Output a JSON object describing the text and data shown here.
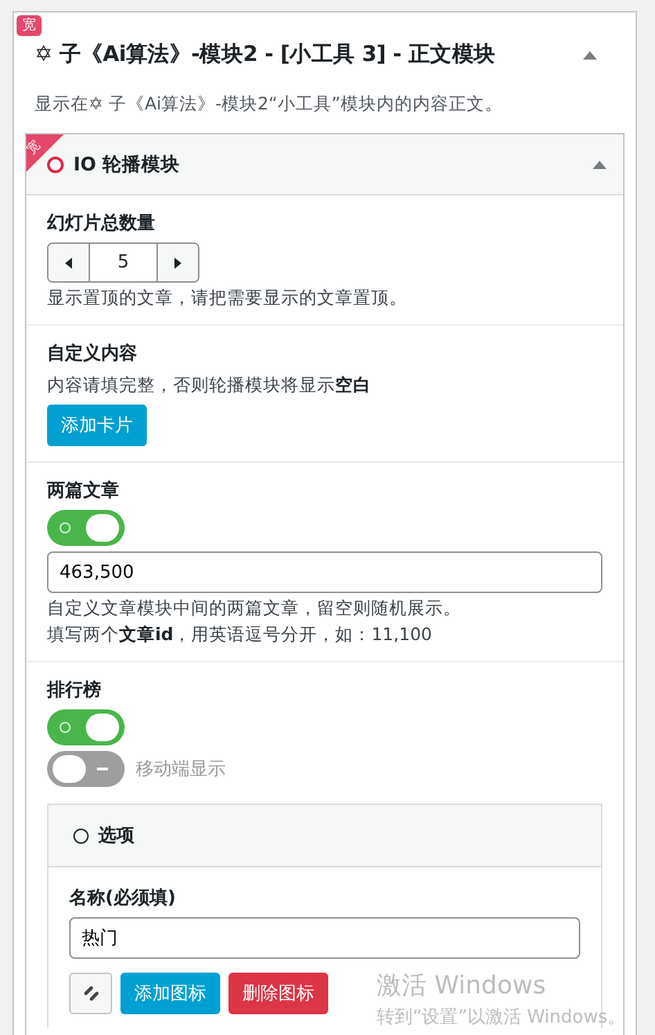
{
  "panel": {
    "badge": "宽",
    "title": "✡ 子《Ai算法》-模块2 - [小工具 3] - 正文模块",
    "expanded": true,
    "description": "显示在✡ 子《Ai算法》-模块2“小工具”模块内的内容正文。",
    "module": {
      "badge": "宽",
      "title": "IO 轮播模块",
      "expanded": true,
      "fields": [
        {
          "kind": "stepper",
          "label": "幻灯片总数量",
          "value": "5",
          "help": [
            "显示置顶的文章，请把需要显示的文章置顶。"
          ]
        },
        {
          "kind": "button",
          "label": "自定义内容",
          "help": [
            "内容请填完整，否则轮播模块将显示**空白**"
          ],
          "button": "添加卡片"
        },
        {
          "kind": "switch_input",
          "label": "两篇文章",
          "on": true,
          "value": "463,500",
          "help": [
            "自定义文章模块中间的两篇文章，留空则随机展示。",
            "填写两个**文章id**，用英语逗号分开，如：11,100"
          ]
        },
        {
          "kind": "switch_group",
          "label": "排行榜",
          "on": true,
          "sub_switch": {
            "label": "移动端显示",
            "on": false
          },
          "group": {
            "title": "选项",
            "name_label": "名称(必须填)",
            "name_value": "热门",
            "buttons": [
              {
                "kind": "icon"
              },
              {
                "kind": "primary",
                "label": "添加图标"
              },
              {
                "kind": "danger",
                "label": "删除图标"
              }
            ]
          }
        }
      ]
    }
  },
  "os_notice": {
    "title": "激活 Windows",
    "text": "转到“设置”以激活 Windows。"
  }
}
